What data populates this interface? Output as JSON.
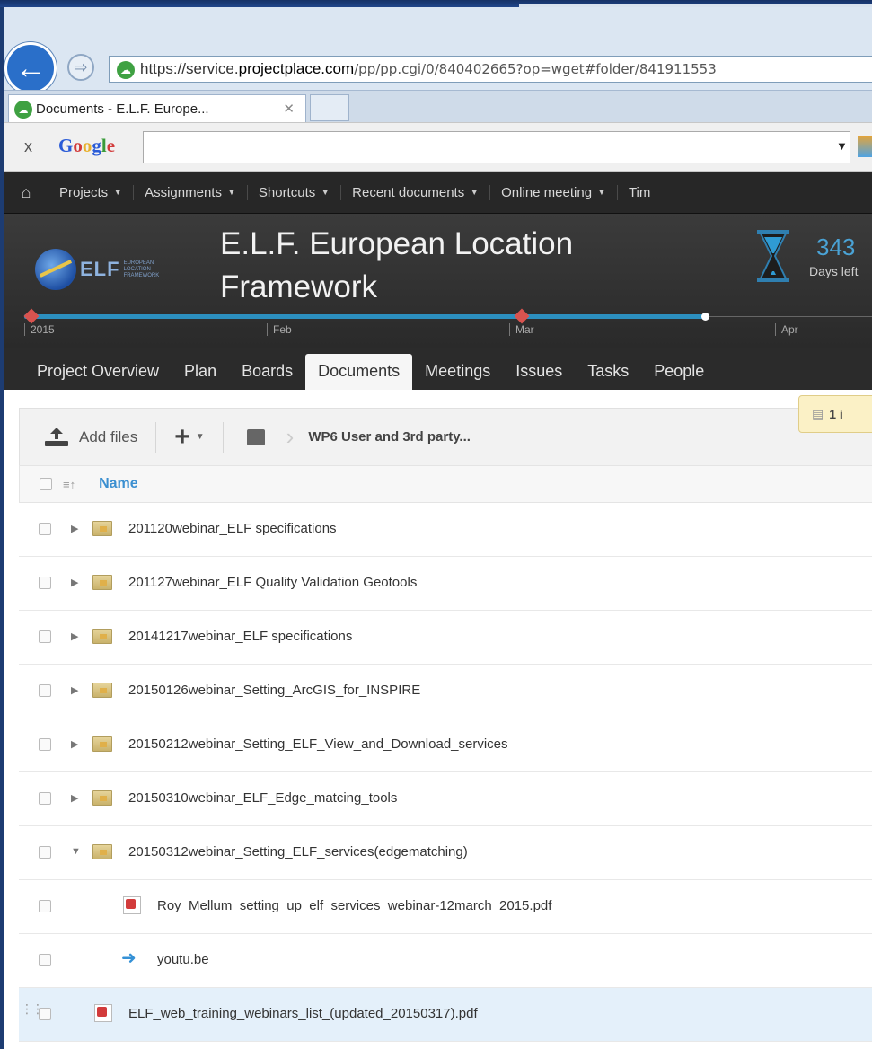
{
  "browser": {
    "url_prefix": "https://service.",
    "url_domain": "projectplace.com",
    "url_path": "/pp/pp.cgi/0/840402665?op=wget#folder/841911553",
    "tab_title": "Documents - E.L.F. Europe...",
    "tab_close": "✕",
    "google_close": "x",
    "google_logo": "Google"
  },
  "top_nav": {
    "items": [
      {
        "label": "Projects"
      },
      {
        "label": "Assignments"
      },
      {
        "label": "Shortcuts"
      },
      {
        "label": "Recent documents"
      },
      {
        "label": "Online meeting"
      },
      {
        "label": "Tim"
      }
    ]
  },
  "project": {
    "title": "E.L.F. European Location Framework",
    "logo_text": "ELF",
    "logo_small": "EUROPEAN LOCATION FRAMEWORK",
    "days_left_num": "343",
    "days_left_label": "Days left",
    "timeline_labels": [
      "2015",
      "Feb",
      "Mar",
      "Apr"
    ]
  },
  "section_tabs": [
    {
      "label": "Project Overview",
      "active": false
    },
    {
      "label": "Plan",
      "active": false
    },
    {
      "label": "Boards",
      "active": false
    },
    {
      "label": "Documents",
      "active": true
    },
    {
      "label": "Meetings",
      "active": false
    },
    {
      "label": "Issues",
      "active": false
    },
    {
      "label": "Tasks",
      "active": false
    },
    {
      "label": "People",
      "active": false
    }
  ],
  "toolbar": {
    "add_files": "Add files",
    "plus": "+",
    "path": "WP6 User and 3rd party...",
    "tooltip": "1 i"
  },
  "list": {
    "name_header": "Name",
    "rows": [
      {
        "name": "201120webinar_ELF specifications",
        "type": "folder",
        "expanded": false
      },
      {
        "name": "201127webinar_ELF Quality Validation Geotools",
        "type": "folder",
        "expanded": false
      },
      {
        "name": "20141217webinar_ELF specifications",
        "type": "folder",
        "expanded": false
      },
      {
        "name": "20150126webinar_Setting_ArcGIS_for_INSPIRE",
        "type": "folder",
        "expanded": false
      },
      {
        "name": "20150212webinar_Setting_ELF_View_and_Download_services",
        "type": "folder",
        "expanded": false
      },
      {
        "name": "20150310webinar_ELF_Edge_matcing_tools",
        "type": "folder",
        "expanded": false
      },
      {
        "name": "20150312webinar_Setting_ELF_services(edgematching)",
        "type": "folder",
        "expanded": true
      },
      {
        "name": "Roy_Mellum_setting_up_elf_services_webinar-12march_2015.pdf",
        "type": "pdf",
        "child": true
      },
      {
        "name": "youtu.be",
        "type": "link",
        "child": true
      },
      {
        "name": "ELF_web_training_webinars_list_(updated_20150317).pdf",
        "type": "pdf",
        "child": false,
        "highlight": true
      }
    ]
  }
}
